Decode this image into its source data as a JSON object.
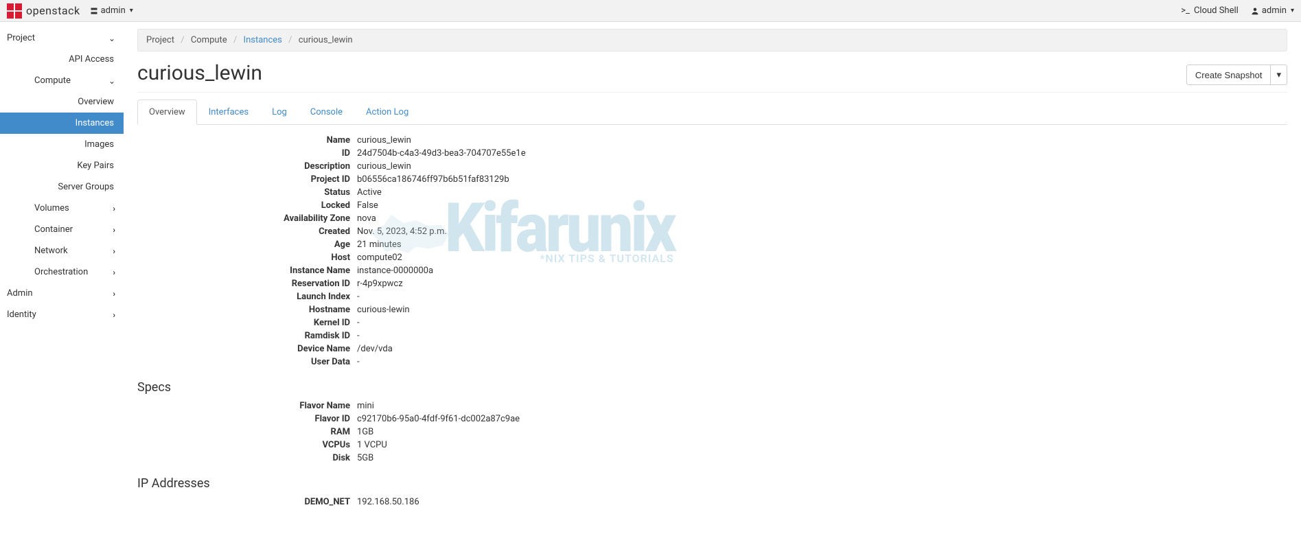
{
  "topbar": {
    "brand": "openstack",
    "context": "admin",
    "cloudshell": "Cloud Shell",
    "cloudshell_prefix": ">_",
    "user": "admin"
  },
  "sidebar": {
    "project": "Project",
    "api_access": "API Access",
    "compute": "Compute",
    "overview": "Overview",
    "instances": "Instances",
    "images": "Images",
    "keypairs": "Key Pairs",
    "server_groups": "Server Groups",
    "volumes": "Volumes",
    "container": "Container",
    "network": "Network",
    "orchestration": "Orchestration",
    "admin": "Admin",
    "identity": "Identity"
  },
  "breadcrumbs": {
    "project": "Project",
    "compute": "Compute",
    "instances": "Instances",
    "current": "curious_lewin"
  },
  "page": {
    "title": "curious_lewin",
    "create_snapshot": "Create Snapshot"
  },
  "tabs": {
    "overview": "Overview",
    "interfaces": "Interfaces",
    "log": "Log",
    "console": "Console",
    "actionlog": "Action Log"
  },
  "labels": {
    "name": "Name",
    "id": "ID",
    "description": "Description",
    "project_id": "Project ID",
    "status": "Status",
    "locked": "Locked",
    "az": "Availability Zone",
    "created": "Created",
    "age": "Age",
    "host": "Host",
    "instance_name": "Instance Name",
    "reservation_id": "Reservation ID",
    "launch_index": "Launch Index",
    "hostname": "Hostname",
    "kernel_id": "Kernel ID",
    "ramdisk_id": "Ramdisk ID",
    "device_name": "Device Name",
    "user_data": "User Data",
    "specs": "Specs",
    "flavor_name": "Flavor Name",
    "flavor_id": "Flavor ID",
    "ram": "RAM",
    "vcpus": "VCPUs",
    "disk": "Disk",
    "ip_addresses": "IP Addresses",
    "demo_net": "DEMO_NET"
  },
  "values": {
    "name": "curious_lewin",
    "id": "24d7504b-c4a3-49d3-bea3-704707e55e1e",
    "description": "curious_lewin",
    "project_id": "b06556ca186746ff97b6b51faf83129b",
    "status": "Active",
    "locked": "False",
    "az": "nova",
    "created": "Nov. 5, 2023, 4:52 p.m.",
    "age": "21 minutes",
    "host": "compute02",
    "instance_name": "instance-0000000a",
    "reservation_id": "r-4p9xpwcz",
    "launch_index": "-",
    "hostname": "curious-lewin",
    "kernel_id": "-",
    "ramdisk_id": "-",
    "device_name": "/dev/vda",
    "user_data": "-",
    "flavor_name": "mini",
    "flavor_id": "c92170b6-95a0-4fdf-9f61-dc002a87c9ae",
    "ram": "1GB",
    "vcpus": "1 VCPU",
    "disk": "5GB",
    "demo_net": "192.168.50.186"
  },
  "watermark": {
    "big": "Kifarunix",
    "sub": "*NIX TIPS & TUTORIALS"
  }
}
